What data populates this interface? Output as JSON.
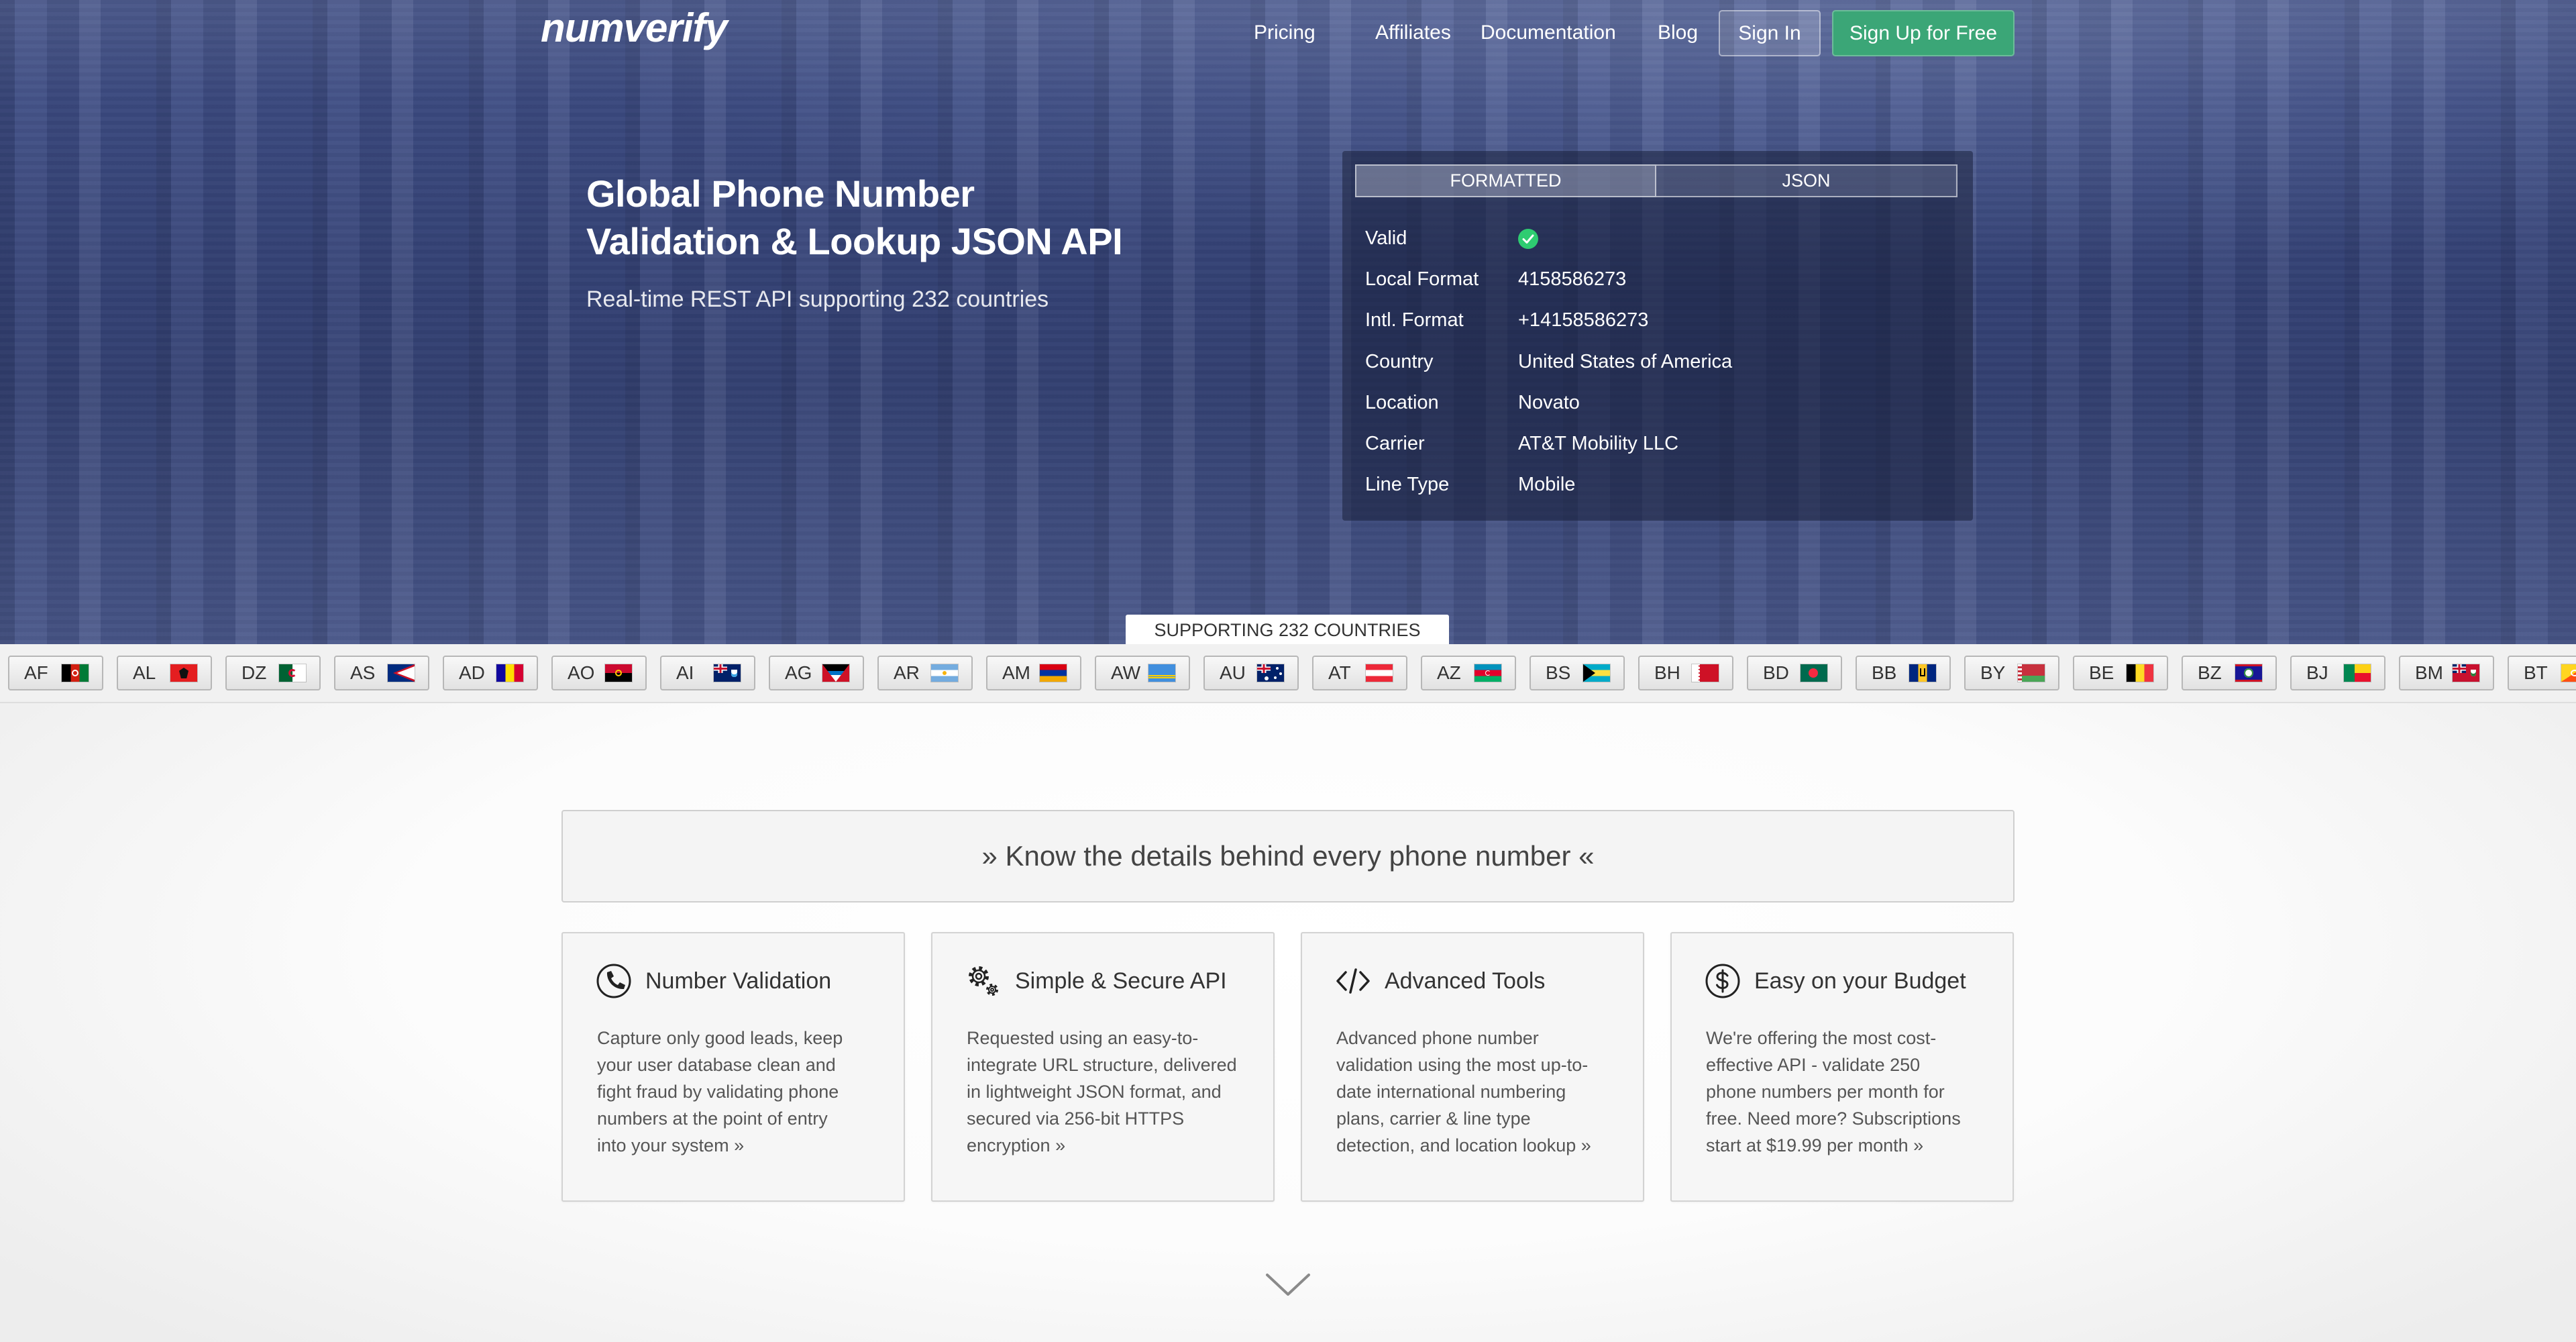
{
  "header": {
    "logo": "numverify",
    "nav": [
      {
        "label": "Pricing"
      },
      {
        "label": "Affiliates"
      },
      {
        "label": "Documentation"
      },
      {
        "label": "Blog"
      }
    ],
    "signin_label": "Sign In",
    "signup_label": "Sign Up for Free"
  },
  "hero": {
    "title_line1": "Global Phone Number",
    "title_line2": "Validation & Lookup JSON API",
    "subtitle": "Real-time REST API supporting 232 countries"
  },
  "result": {
    "tabs": [
      {
        "label": "FORMATTED",
        "active": true
      },
      {
        "label": "JSON",
        "active": false
      }
    ],
    "rows": [
      {
        "label": "Valid",
        "valid": true,
        "icon": "check-circle-icon"
      },
      {
        "label": "Local Format",
        "value": "4158586273"
      },
      {
        "label": "Intl. Format",
        "value": "+14158586273"
      },
      {
        "label": "Country",
        "value": "United States of America"
      },
      {
        "label": "Location",
        "value": "Novato"
      },
      {
        "label": "Carrier",
        "value": "AT&T Mobility LLC"
      },
      {
        "label": "Line Type",
        "value": "Mobile"
      }
    ]
  },
  "countries": {
    "tab_label": "SUPPORTING 232 COUNTRIES",
    "items": [
      {
        "code": "AF",
        "icon": "flag-af-icon"
      },
      {
        "code": "AL",
        "icon": "flag-al-icon"
      },
      {
        "code": "DZ",
        "icon": "flag-dz-icon"
      },
      {
        "code": "AS",
        "icon": "flag-as-icon"
      },
      {
        "code": "AD",
        "icon": "flag-ad-icon"
      },
      {
        "code": "AO",
        "icon": "flag-ao-icon"
      },
      {
        "code": "AI",
        "icon": "flag-ai-icon"
      },
      {
        "code": "AG",
        "icon": "flag-ag-icon"
      },
      {
        "code": "AR",
        "icon": "flag-ar-icon"
      },
      {
        "code": "AM",
        "icon": "flag-am-icon"
      },
      {
        "code": "AW",
        "icon": "flag-aw-icon"
      },
      {
        "code": "AU",
        "icon": "flag-au-icon"
      },
      {
        "code": "AT",
        "icon": "flag-at-icon"
      },
      {
        "code": "AZ",
        "icon": "flag-az-icon"
      },
      {
        "code": "BS",
        "icon": "flag-bs-icon"
      },
      {
        "code": "BH",
        "icon": "flag-bh-icon"
      },
      {
        "code": "BD",
        "icon": "flag-bd-icon"
      },
      {
        "code": "BB",
        "icon": "flag-bb-icon"
      },
      {
        "code": "BY",
        "icon": "flag-by-icon"
      },
      {
        "code": "BE",
        "icon": "flag-be-icon"
      },
      {
        "code": "BZ",
        "icon": "flag-bz-icon"
      },
      {
        "code": "BJ",
        "icon": "flag-bj-icon"
      },
      {
        "code": "BM",
        "icon": "flag-bm-icon"
      },
      {
        "code": "BT",
        "icon": "flag-bt-icon"
      }
    ]
  },
  "tagline": "» Know the details behind every phone number «",
  "features": [
    {
      "icon": "phone-circle-icon",
      "title": "Number Validation",
      "lines": [
        "Capture only good leads, keep",
        "your user database clean and",
        "fight fraud by validating phone",
        "numbers at the point of entry",
        "into your system »"
      ]
    },
    {
      "icon": "gears-icon",
      "title": "Simple & Secure API",
      "lines": [
        "Requested using an easy-to-",
        "integrate URL structure, delivered",
        "in lightweight JSON format, and",
        "secured via 256-bit HTTPS",
        "encryption »"
      ]
    },
    {
      "icon": "code-icon",
      "title": "Advanced Tools",
      "lines": [
        "Advanced phone number",
        "validation using the most up-to-",
        "date international numbering",
        "plans, carrier & line type",
        "detection, and location lookup »"
      ]
    },
    {
      "icon": "dollar-circle-icon",
      "title": "Easy on your Budget",
      "lines": [
        "We're offering the most cost-",
        "effective API - validate 250",
        "phone numbers per month for",
        "free. Need more? Subscriptions",
        "start at $19.99 per month »"
      ]
    }
  ],
  "scroll_icon": "chevron-down-icon",
  "colors": {
    "signup_button": "#3ba677",
    "valid_check": "#2ecc71",
    "hero_blue": "#3b4a81"
  }
}
